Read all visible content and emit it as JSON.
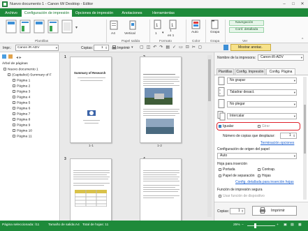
{
  "titlebar": {
    "title": "Nuevo documento 1 - Canon iW Desktop - Editor"
  },
  "tabs": [
    "Archivo",
    "Configuración de impresión",
    "Opciones de impresión",
    "Anotaciones",
    "Herramientas"
  ],
  "ribbon": {
    "groups": {
      "plantillas": "Plantillas",
      "papel_salida": "Papel salida",
      "formato": "Formato",
      "color": "Color",
      "grapa": "Grapa",
      "ver": "Ver"
    },
    "size_value": "A4",
    "orientation_value": "Vertical",
    "sides_value": "1",
    "layout_top": "1",
    "layout_bottom": "en 1",
    "color_value": "Auto",
    "staple_value": "Grapa",
    "view_navigation": "Navegación",
    "view_detail": "Conf. detallada"
  },
  "toolbar": {
    "printer_label": "Impr.:",
    "printer_value": "Canon iR-ADV",
    "copies_label": "Copias:",
    "copies_value": "1",
    "print_button": "Imprimir",
    "show_annotations": "Mostrar anotac."
  },
  "tree": {
    "header": "Árbol de páginas",
    "root": "Nuevo documento 1",
    "doc": "(Capitalicé) Summary of F",
    "pages": [
      "Página 1",
      "Página 2",
      "Página 3",
      "Página 4",
      "Página 5",
      "Página 6",
      "Página 7",
      "Página 8",
      "Página 9",
      "Página 10",
      "Página 11"
    ]
  },
  "preview": {
    "page_numbers": [
      "1",
      "2",
      "3",
      "4"
    ],
    "labels": [
      "1-1",
      "1-2"
    ],
    "page1_title": "Summary of Research"
  },
  "rightpane": {
    "printer_name_label": "Nombre de la impresora:",
    "printer_name_value": "Canon iR-ADV",
    "tabs": [
      "Plantillas",
      "Config. Impresión",
      "Config. Página"
    ],
    "no_grapar": "No grapar",
    "taladrar": "Taladrar desact.",
    "no_plegar": "No plegar",
    "intercalar": "Intercalar",
    "igualar": "Igualar",
    "girar": "Girar",
    "copies_label": "Número de copias que desplazar:",
    "copies_value": "1",
    "advanced_options": "Terminación opciones",
    "paper_origin_label": "Configuración de origen del papel",
    "paper_origin_value": "Auto",
    "insert_sheet_label": "Hoja para inserción",
    "portada": "Portada",
    "contra": "Contrap.",
    "papel_sep": "Papel de separación",
    "hojas": "Hojas",
    "insert_detail_link": "Config. detallada para inserción hojas",
    "secure_label": "Función de impresión segura",
    "secure_check": "Usar función de dispositivo",
    "bottom_copies_label": "Copias:",
    "bottom_copies_value": "1",
    "print_button": "Imprimir"
  },
  "status": {
    "selected_pages": "Página seleccionada: /11",
    "output_size": "Tamaño de salida:A4",
    "total_sheets": "Total de hojas: 11",
    "zoom": "25%"
  },
  "colors": {
    "brand_green": "#1e8a3a",
    "highlight_red": "#e0202a"
  }
}
